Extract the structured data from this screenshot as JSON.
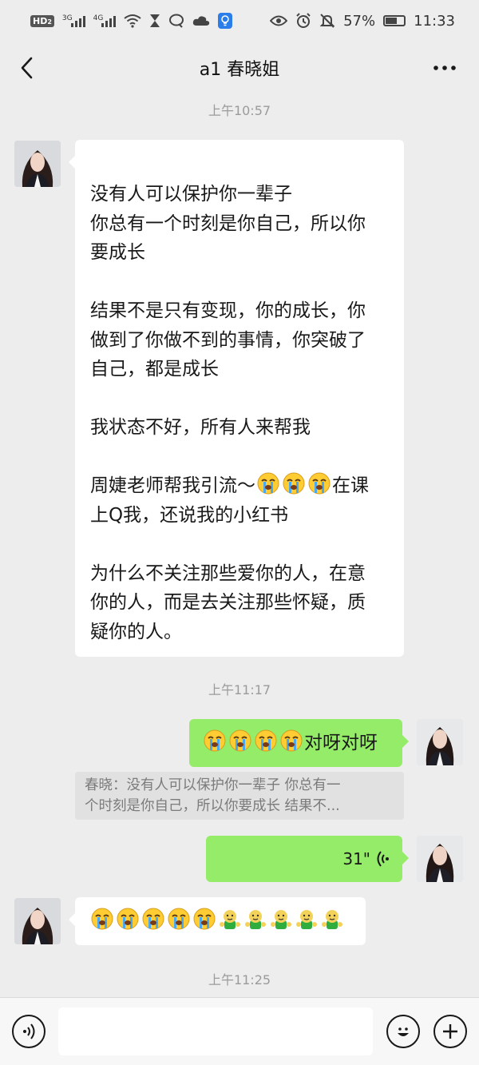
{
  "status_bar": {
    "hd_label": "HD",
    "hd_sub": "2",
    "net1": "3G",
    "net2": "4G",
    "battery_percent": "57%",
    "time": "11:33",
    "icons": [
      "hd-icon",
      "signal-icon",
      "wifi-icon",
      "hourglass-icon",
      "chat-bubble-icon",
      "cloud-icon",
      "bulb-icon",
      "eye-icon",
      "alarm-icon",
      "mute-icon",
      "battery-icon"
    ]
  },
  "header": {
    "title": "a1 春晓姐",
    "back_icon": "chevron-left-icon",
    "more_icon": "more-dots-icon"
  },
  "messages": {
    "time1": "上午10:57",
    "msg1": {
      "p1": [
        "没有人可以保护你一辈子",
        "你总有一个时刻是你自己，所以你",
        "要成长"
      ],
      "p2": [
        "结果不是只有变现，你的成长，你",
        "做到了你做不到的事情，你突破了",
        "自己，都是成长"
      ],
      "p3": [
        "我状态不好，所有人来帮我"
      ],
      "p4_line1_pre": "周婕老师帮我引流～",
      "p4_line1_post": "在课",
      "p4_line2": "上Q我，还说我的小红书",
      "p5": [
        "为什么不关注那些爱你的人，在意",
        "你的人，而是去关注那些怀疑，质",
        "疑你的人。"
      ]
    },
    "time2": "上午11:17",
    "msg2_text": "对呀对呀",
    "quote": {
      "line1": "春晓：没有人可以保护你一辈子 你总有一",
      "line2": "个时刻是你自己，所以你要成长  结果不..."
    },
    "voice_duration": "31\"",
    "time3": "上午11:25"
  },
  "input_bar": {
    "voice_icon": "voice-input-icon",
    "emoji_icon": "emoji-icon",
    "plus_icon": "plus-icon"
  },
  "colors": {
    "background": "#ededed",
    "self_bubble": "#95ec69",
    "other_bubble": "#ffffff"
  }
}
